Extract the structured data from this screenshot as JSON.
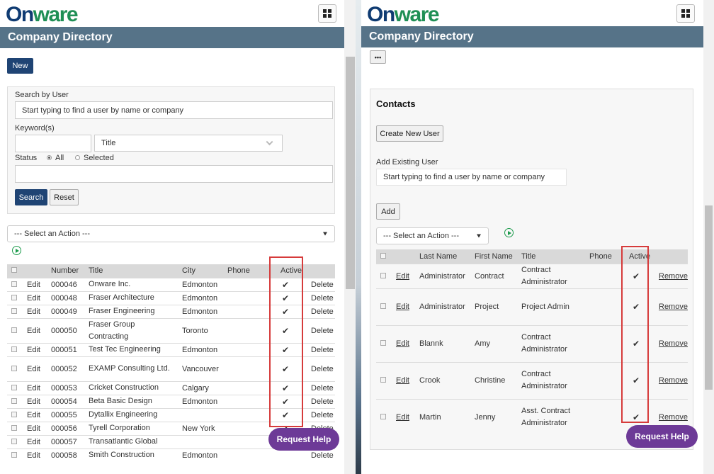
{
  "brand": {
    "logo_on": "On",
    "logo_ware": "ware"
  },
  "left": {
    "title": "Company Directory",
    "new_label": "New",
    "search": {
      "user_label": "Search by User",
      "user_placeholder": "Start typing to find a user by name or company",
      "keyword_label": "Keyword(s)",
      "keyword_value": "",
      "title_select": "Title",
      "status_label": "Status",
      "status_all": "All",
      "status_selected": "Selected",
      "search_label": "Search",
      "reset_label": "Reset"
    },
    "action_select": "--- Select an Action ---",
    "columns": [
      "Number",
      "Title",
      "City",
      "Phone",
      "Active"
    ],
    "edit_label": "Edit",
    "delete_label": "Delete",
    "rows": [
      {
        "number": "000046",
        "title": "Onware Inc.",
        "city": "Edmonton",
        "phone": "",
        "active": "✔"
      },
      {
        "number": "000048",
        "title": "Fraser Architecture",
        "city": "Edmonton",
        "phone": "",
        "active": "✔"
      },
      {
        "number": "000049",
        "title": "Fraser Engineering",
        "city": "Edmonton",
        "phone": "",
        "active": "✔"
      },
      {
        "number": "000050",
        "title": "Fraser Group Contracting",
        "city": "Toronto",
        "phone": "",
        "active": "✔"
      },
      {
        "number": "000051",
        "title": "Test Tec Engineering",
        "city": "Edmonton",
        "phone": "",
        "active": "✔"
      },
      {
        "number": "000052",
        "title": "EXAMP Consulting Ltd.",
        "city": "Vancouver",
        "phone": "",
        "active": "✔"
      },
      {
        "number": "000053",
        "title": "Cricket Construction",
        "city": "Calgary",
        "phone": "",
        "active": "✔"
      },
      {
        "number": "000054",
        "title": "Beta Basic Design",
        "city": "Edmonton",
        "phone": "",
        "active": "✔"
      },
      {
        "number": "000055",
        "title": "Dytallix Engineering",
        "city": "",
        "phone": "",
        "active": "✔"
      },
      {
        "number": "000056",
        "title": "Tyrell Corporation",
        "city": "New York",
        "phone": "",
        "active": "✔"
      },
      {
        "number": "000057",
        "title": "Transatlantic Global",
        "city": "",
        "phone": "",
        "active": ""
      },
      {
        "number": "000058",
        "title": "Smith Construction",
        "city": "Edmonton",
        "phone": "",
        "active": ""
      }
    ]
  },
  "right": {
    "title": "Company Directory",
    "more_label": "•••",
    "contacts_title": "Contacts",
    "create_label": "Create New User",
    "add_existing_label": "Add Existing User",
    "add_existing_placeholder": "Start typing to find a user by name or company",
    "add_label": "Add",
    "action_select": "--- Select an Action ---",
    "columns": [
      "Last Name",
      "First Name",
      "Title",
      "Phone",
      "Active"
    ],
    "edit_label": "Edit",
    "remove_label": "Remove",
    "rows": [
      {
        "last": "Administrator",
        "first": "Contract",
        "title": "Contract Administrator",
        "phone": "",
        "active": "✔"
      },
      {
        "last": "Administrator",
        "first": "Project",
        "title": "Project Admin",
        "phone": "",
        "active": "✔"
      },
      {
        "last": "Blannk",
        "first": "Amy",
        "title": "Contract Administrator",
        "phone": "",
        "active": "✔"
      },
      {
        "last": "Crook",
        "first": "Christine",
        "title": "Contract Administrator",
        "phone": "",
        "active": "✔"
      },
      {
        "last": "Martin",
        "first": "Jenny",
        "title": "Asst. Contract Administrator",
        "phone": "",
        "active": "✔"
      }
    ]
  },
  "help_label": "Request Help",
  "colors": {
    "header": "#567388",
    "primary": "#1f4474",
    "link": "#1a9a4a",
    "help": "#6d3a97",
    "highlight": "#d63b3b"
  }
}
